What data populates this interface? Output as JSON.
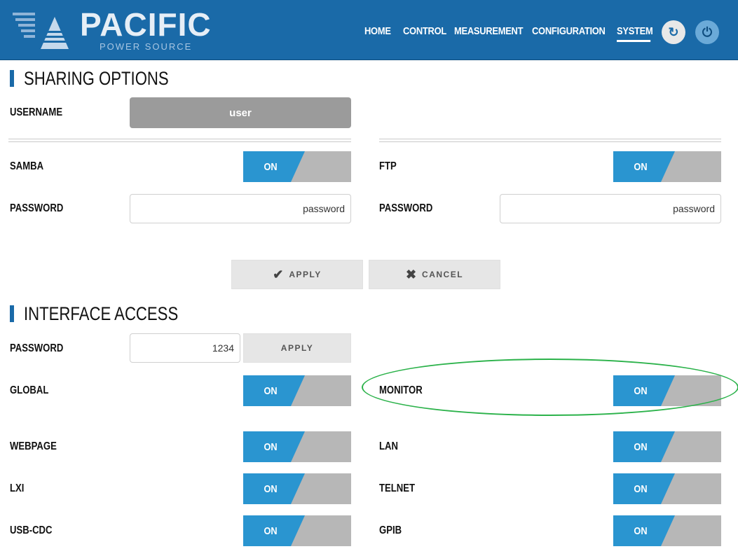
{
  "header": {
    "brand": "PACIFIC",
    "brand_sub": "POWER SOURCE",
    "nav": [
      "HOME",
      "CONTROL",
      "MEASUREMENT",
      "CONFIGURATION",
      "SYSTEM"
    ],
    "active_nav": "SYSTEM",
    "refresh_icon": "refresh-icon",
    "power_icon": "power-icon",
    "colors": {
      "bar": "#1a6aa8",
      "accent": "#2a95d0"
    }
  },
  "sharing": {
    "title": "SHARING OPTIONS",
    "username_label": "USERNAME",
    "username_value": "user",
    "samba_label": "SAMBA",
    "samba_state": "ON",
    "ftp_label": "FTP",
    "ftp_state": "ON",
    "samba_password_label": "PASSWORD",
    "samba_password_placeholder": "password",
    "ftp_password_label": "PASSWORD",
    "ftp_password_placeholder": "password",
    "apply_label": "APPLY",
    "cancel_label": "CANCEL"
  },
  "interface": {
    "title": "INTERFACE ACCESS",
    "password_label": "PASSWORD",
    "password_value": "1234",
    "apply_label": "APPLY",
    "toggles": {
      "global": {
        "label": "GLOBAL",
        "state": "ON"
      },
      "monitor": {
        "label": "MONITOR",
        "state": "ON"
      },
      "webpage": {
        "label": "WEBPAGE",
        "state": "ON"
      },
      "lan": {
        "label": "LAN",
        "state": "ON"
      },
      "lxi": {
        "label": "LXI",
        "state": "ON"
      },
      "telnet": {
        "label": "TELNET",
        "state": "ON"
      },
      "usbcdc": {
        "label": "USB-CDC",
        "state": "ON"
      },
      "gpib": {
        "label": "GPIB",
        "state": "ON"
      }
    }
  }
}
